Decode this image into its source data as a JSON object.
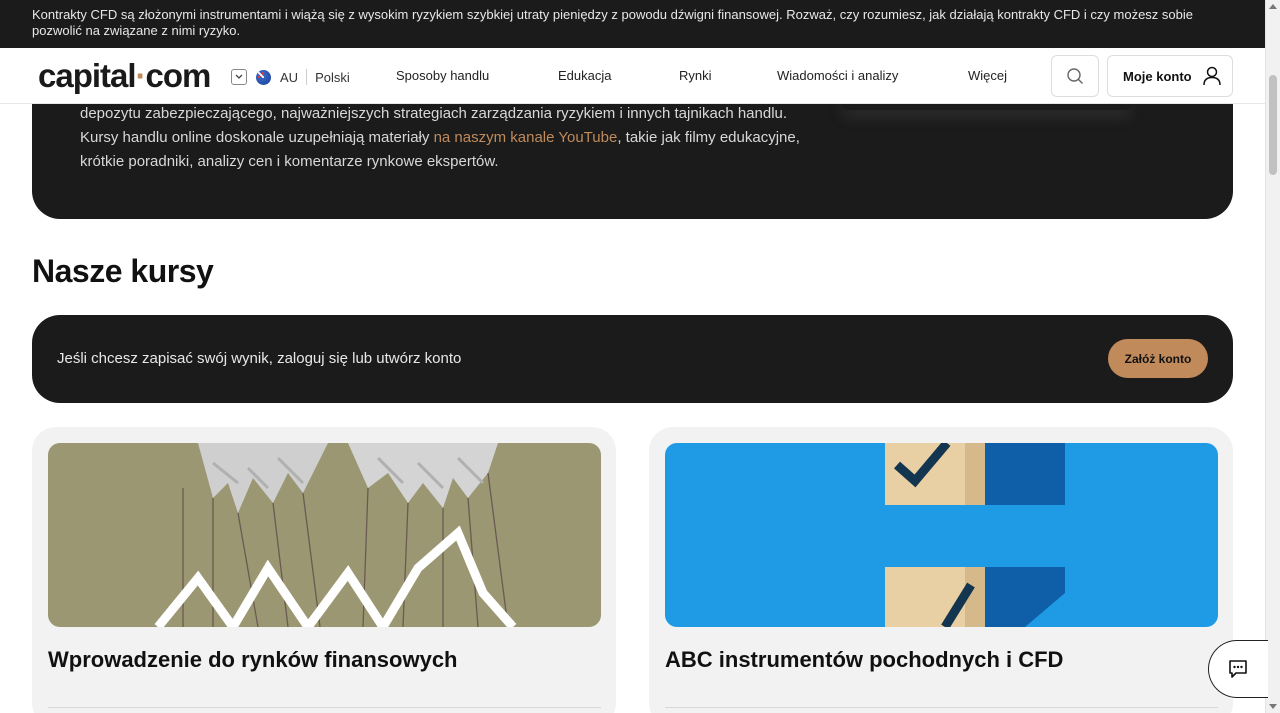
{
  "risk_banner": {
    "text": "Kontrakty CFD są złożonymi instrumentami i wiążą się z wysokim ryzykiem szybkiej utraty pieniędzy z powodu dźwigni finansowej. Rozważ, czy rozumiesz, jak działają kontrakty CFD i czy możesz sobie pozwolić na związane z nimi ryzyko."
  },
  "header": {
    "logo_left": "capital",
    "logo_dot": "·",
    "logo_right": "com",
    "region_code": "AU",
    "language": "Polski",
    "nav": [
      "Sposoby handlu",
      "Edukacja",
      "Rynki",
      "Wiadomości i analizy",
      "Więcej"
    ],
    "account_label": "Moje konto"
  },
  "intro": {
    "line1": "depozytu zabezpieczającego, najważniejszych strategiach zarządzania ryzykiem i innych tajnikach handlu. Kursy handlu online doskonale uzupełniają materiały ",
    "link_text": "na naszym kanale YouTube",
    "line2": ", takie jak filmy edukacyjne, krótkie poradniki, analizy cen i komentarze rynkowe ekspertów."
  },
  "section": {
    "title": "Nasze kursy"
  },
  "login_prompt": {
    "text": "Jeśli chcesz zapisać swój wynik, zaloguj się lub utwórz konto",
    "button": "Załóż konto"
  },
  "courses": [
    {
      "title": "Wprowadzenie do rynków finansowych"
    },
    {
      "title": "ABC instrumentów pochodnych i CFD"
    }
  ],
  "colors": {
    "accent": "#c08a5b",
    "dark": "#1b1b1b",
    "card_bg": "#f2f2f2",
    "image1_bg": "#9b9772",
    "image2_bg": "#1f9be6"
  }
}
